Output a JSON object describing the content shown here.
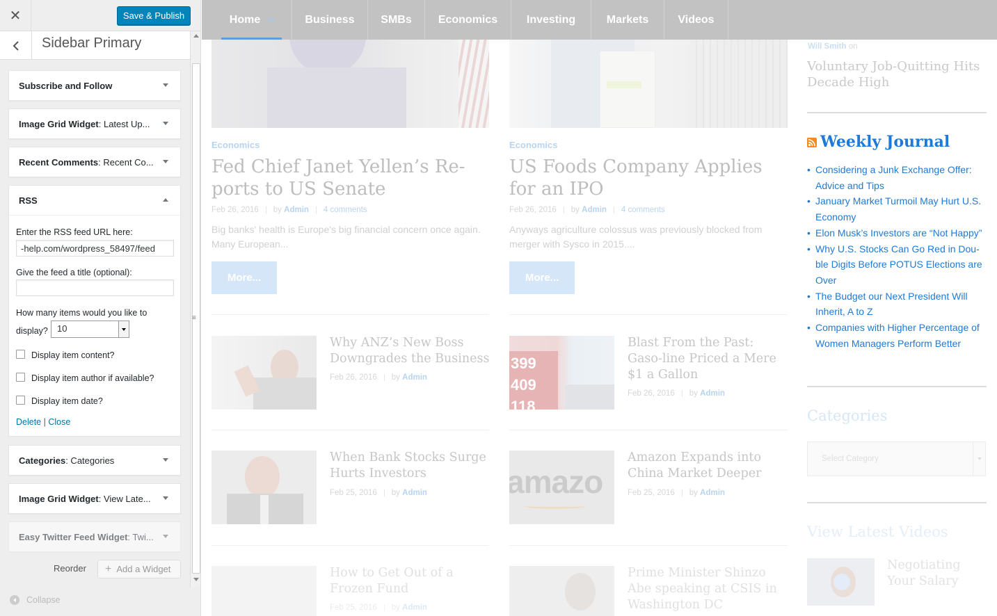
{
  "customizer": {
    "publish_label": "Save & Publish",
    "section_title": "Sidebar Primary",
    "widgets_top": [
      {
        "title": "Subscribe and Follow",
        "subtitle": ""
      },
      {
        "title": "Image Grid Widget",
        "subtitle": ": Latest Up..."
      },
      {
        "title": "Recent Comments",
        "subtitle": ": Recent Co..."
      },
      {
        "title": "RSS",
        "subtitle": ""
      }
    ],
    "rss_form": {
      "url_label": "Enter the RSS feed URL here:",
      "url_value": "-help.com/wordpress_58497/feed",
      "title_label": "Give the feed a title (optional):",
      "title_value": "",
      "items_label_1": "How many items would you like to",
      "items_label_2": "display?",
      "items_value": "10",
      "show_content_label": "Display item content?",
      "show_author_label": "Display item author if available?",
      "show_date_label": "Display item date?",
      "delete_label": "Delete",
      "link_separator": "|",
      "close_label": "Close"
    },
    "widgets_bottom": [
      {
        "title": "Categories",
        "subtitle": ": Categories"
      },
      {
        "title": "Image Grid Widget",
        "subtitle": ": View Late..."
      },
      {
        "title": "Easy Twitter Feed Widget",
        "subtitle": ": Twi..."
      }
    ],
    "reorder_label": "Reorder",
    "add_widget_label": "Add a Widget",
    "collapse_label": "Collapse"
  },
  "nav": {
    "items": [
      "Home",
      "Business",
      "SMBs",
      "Economics",
      "Investing",
      "Markets",
      "Videos"
    ]
  },
  "featured": [
    {
      "category": "Economics",
      "title": "Fed Chief Janet Yellen’s Re-ports to US Senate",
      "date": "Feb 26, 2016",
      "by": "by",
      "author": "Admin",
      "comments": "4 comments",
      "excerpt": "Big banks' health is Europe's big financial concern once again. Many European...",
      "more": "More..."
    },
    {
      "category": "Economics",
      "title": "US Foods Company Applies for an IPO",
      "date": "Feb 26, 2016",
      "by": "by",
      "author": "Admin",
      "comments": "4 comments",
      "excerpt": "Anyways agriculture colossus was previously blocked from merger with Sysco in 2015....",
      "more": "More..."
    }
  ],
  "small_posts": [
    {
      "title": "Why ANZ’s New Boss Downgrades the Business",
      "date": "Feb 26, 2016",
      "by": "by",
      "author": "Admin"
    },
    {
      "title": "Blast From the Past: Gaso-line Priced a Mere $1 a Gallon",
      "date": "Feb 26, 2016",
      "by": "by",
      "author": "Admin"
    },
    {
      "title": "When Bank Stocks Surge Hurts Investors",
      "date": "Feb 25, 2016",
      "by": "by",
      "author": "Admin"
    },
    {
      "title": "Amazon Expands into China Market Deeper",
      "date": "Feb 25, 2016",
      "by": "by",
      "author": "Admin"
    },
    {
      "title": "How to Get Out of a Frozen Fund",
      "date": "Feb 25, 2016",
      "by": "by",
      "author": "Admin"
    },
    {
      "title": "Prime Minister Shinzo Abe speaking at CSIS in Washington DC",
      "date": "",
      "by": "",
      "author": ""
    }
  ],
  "photo_text": {
    "gas_1": "399",
    "gas_2": "409",
    "gas_3": "118",
    "amazon": "amazo"
  },
  "sidebar": {
    "recent_author": "Will Smith",
    "recent_on": "on",
    "recent_title": "Voluntary Job-Quitting Hits Decade High",
    "weekly_title": "Weekly Journal",
    "weekly_items": [
      "Considering a Junk Exchange Offer: Advice and Tips",
      "January Market Turmoil May Hurt U.S. Economy",
      "Elon Musk’s Investors are “Not Happy”",
      "Why U.S. Stocks Can Go Red in Dou-ble Digits Before POTUS Elections are Over",
      "The Budget our Next President Will Inherit, A to Z",
      "Companies with Higher Percentage of Women Managers Perform Better"
    ],
    "categories_title": "Categories",
    "categories_placeholder": "Select Category",
    "videos_title": "View Latest Videos",
    "video_title": "Negotiating Your Salary"
  },
  "colors": {
    "publish": "#0085ba",
    "nav_bg": "#c2c2c2",
    "link": "#1e7ad6",
    "rss_icon": "#f28b22"
  },
  "icons": [
    "close-icon",
    "back-chevron-icon",
    "chevron-down-icon",
    "chevron-up-icon",
    "plus-icon",
    "collapse-icon",
    "rss-icon"
  ]
}
